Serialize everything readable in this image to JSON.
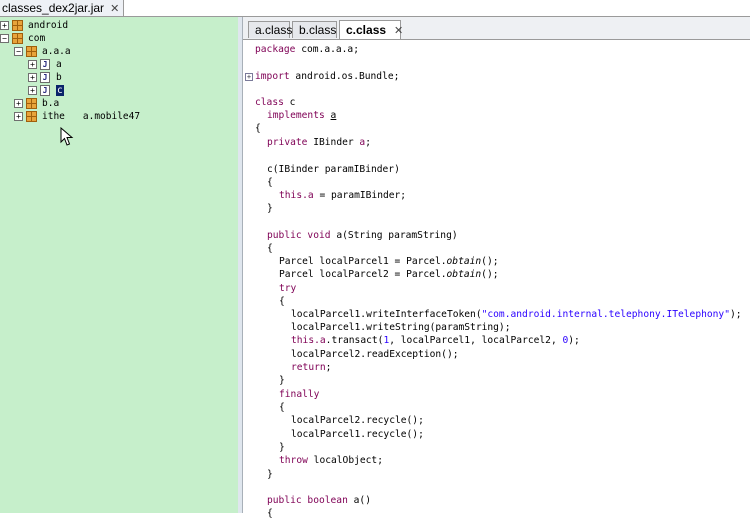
{
  "window": {
    "jar_tab": "classes_dex2jar.jar",
    "close_glyph": "✕"
  },
  "tree": {
    "android": "android",
    "com": "com",
    "pkg_aaa": "a.a.a",
    "cls_a": "a",
    "cls_b": "b",
    "cls_c": "c",
    "pkg_ba": "b.a",
    "pkg_ithe": "ithe",
    "pkg_ithe_rest": "a.mobile47",
    "expand_plus": "+",
    "expand_minus": "−",
    "class_glyph": "J"
  },
  "tabs": [
    {
      "label": "a.class"
    },
    {
      "label": "b.class"
    },
    {
      "label": "c.class"
    }
  ],
  "code": {
    "l1_kw": "package",
    "l1_rest": " com.a.a.a;",
    "l2_kw": "import",
    "l2_rest": " android.os.Bundle;",
    "l3_kw": "class",
    "l3_rest": " c",
    "l4_kw": "implements",
    "l4_ul": "a",
    "l5": "{",
    "l6_kw": "private",
    "l6_rest": " IBinder ",
    "l6_field": "a",
    "l6_end": ";",
    "l7": "c(IBinder paramIBinder)",
    "l8": "{",
    "l9_kw": "this",
    "l9_field": ".a",
    "l9_rest": " = paramIBinder;",
    "l10": "}",
    "l11_kw1": "public",
    "l11_kw2": " void",
    "l11_rest": " a(String paramString)",
    "l12": "{",
    "l13_a": "Parcel localParcel1 = Parcel.",
    "l13_it": "obtain",
    "l13_b": "();",
    "l14_a": "Parcel localParcel2 = Parcel.",
    "l14_it": "obtain",
    "l14_b": "();",
    "l15_kw": "try",
    "l16": "{",
    "l17_a": "localParcel1.writeInterfaceToken(",
    "l17_str": "\"com.android.internal.telephony.ITelephony\"",
    "l17_b": ");",
    "l18": "localParcel1.writeString(paramString);",
    "l19_kw": "this",
    "l19_field": ".a",
    "l19_a": ".transact(",
    "l19_n1": "1",
    "l19_b": ", localParcel1, localParcel2, ",
    "l19_n2": "0",
    "l19_c": ");",
    "l20": "localParcel2.readException();",
    "l21_kw": "return",
    "l21_end": ";",
    "l22": "}",
    "l23_kw": "finally",
    "l24": "{",
    "l25": "localParcel2.recycle();",
    "l26": "localParcel1.recycle();",
    "l27": "}",
    "l28_kw": "throw",
    "l28_rest": " localObject;",
    "l29": "}",
    "l30_kw1": "public",
    "l30_kw2": " boolean",
    "l30_rest": " a()",
    "l31": "{"
  },
  "colors": {
    "tree_bg": "#c6efcb",
    "keyword": "#7f0055",
    "string": "#2a00ff",
    "selection": "#0a246a"
  }
}
